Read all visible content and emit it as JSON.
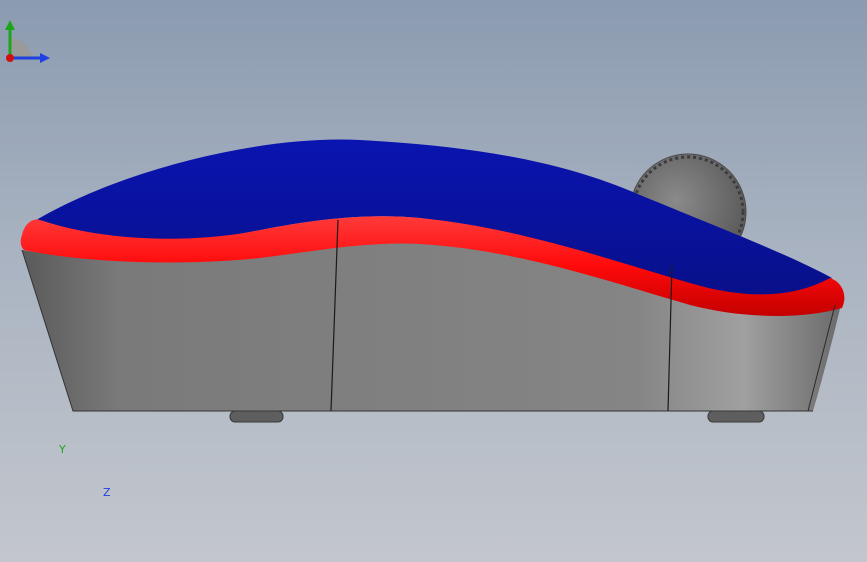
{
  "viewport": {
    "background_top": "#8b9bb0",
    "background_bottom": "#c3c7cd"
  },
  "model": {
    "shell_color": "#0a1aa0",
    "rim_color": "#ff1010",
    "base_color": "#7a7a7a",
    "wheel_color": "#6e6e6e"
  },
  "triad": {
    "y_label": "Y",
    "z_label": "Z",
    "y_color": "#1ea51e",
    "z_color": "#2040e0",
    "origin_color": "#d01010",
    "icons": [
      "triad-y-arrow-icon",
      "triad-z-arrow-icon",
      "triad-origin-icon"
    ]
  }
}
